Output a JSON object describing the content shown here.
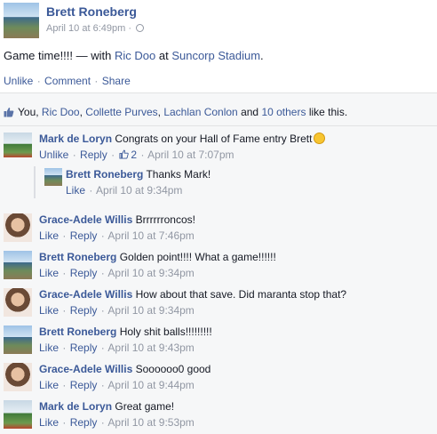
{
  "post": {
    "author": "Brett Roneberg",
    "timestamp": "April 10 at 6:49pm",
    "meta_separator": "·",
    "text_prefix": "Game time!!!! — with ",
    "tagged_person": "Ric Doo",
    "text_at": " at ",
    "location": "Suncorp Stadium",
    "text_suffix": ".",
    "actions": {
      "unlike": "Unlike",
      "comment": "Comment",
      "share": "Share",
      "separator": "·"
    }
  },
  "likes": {
    "you": "You, ",
    "person1": "Ric Doo",
    "comma1": ", ",
    "person2": "Collette Purves",
    "comma2": ", ",
    "person3": "Lachlan Conlon",
    "and": " and ",
    "others": "10 others",
    "suffix": " like this."
  },
  "comments": [
    {
      "author": "Mark de Loryn",
      "text": "Congrats on your Hall of Fame entry Brett",
      "emoji": "smile-emoji",
      "actions": [
        "Unlike",
        "Reply"
      ],
      "like_count": "2",
      "timestamp": "April 10 at 7:07pm",
      "replies": [
        {
          "author": "Brett Roneberg",
          "text": "Thanks Mark!",
          "actions": [
            "Like"
          ],
          "timestamp": "April 10 at 9:34pm"
        }
      ]
    },
    {
      "author": "Grace-Adele Willis",
      "text": "Brrrrrroncos!",
      "actions": [
        "Like",
        "Reply"
      ],
      "timestamp": "April 10 at 7:46pm"
    },
    {
      "author": "Brett Roneberg",
      "text": "Golden point!!!! What a game!!!!!!",
      "actions": [
        "Like",
        "Reply"
      ],
      "timestamp": "April 10 at 9:34pm"
    },
    {
      "author": "Grace-Adele Willis",
      "text": "How about that save. Did maranta stop that?",
      "actions": [
        "Like",
        "Reply"
      ],
      "timestamp": "April 10 at 9:34pm"
    },
    {
      "author": "Brett Roneberg",
      "text": "Holy shit balls!!!!!!!!!",
      "actions": [
        "Like",
        "Reply"
      ],
      "timestamp": "April 10 at 9:43pm"
    },
    {
      "author": "Grace-Adele Willis",
      "text": "Soooooo0 good",
      "actions": [
        "Like",
        "Reply"
      ],
      "timestamp": "April 10 at 9:44pm"
    },
    {
      "author": "Mark de Loryn",
      "text": "Great game!",
      "actions": [
        "Like",
        "Reply"
      ],
      "timestamp": "April 10 at 9:53pm"
    }
  ],
  "separator": "·",
  "colors": {
    "link": "#3b5998",
    "meta": "#9197a3",
    "ufi_bg": "#f6f7f8"
  }
}
